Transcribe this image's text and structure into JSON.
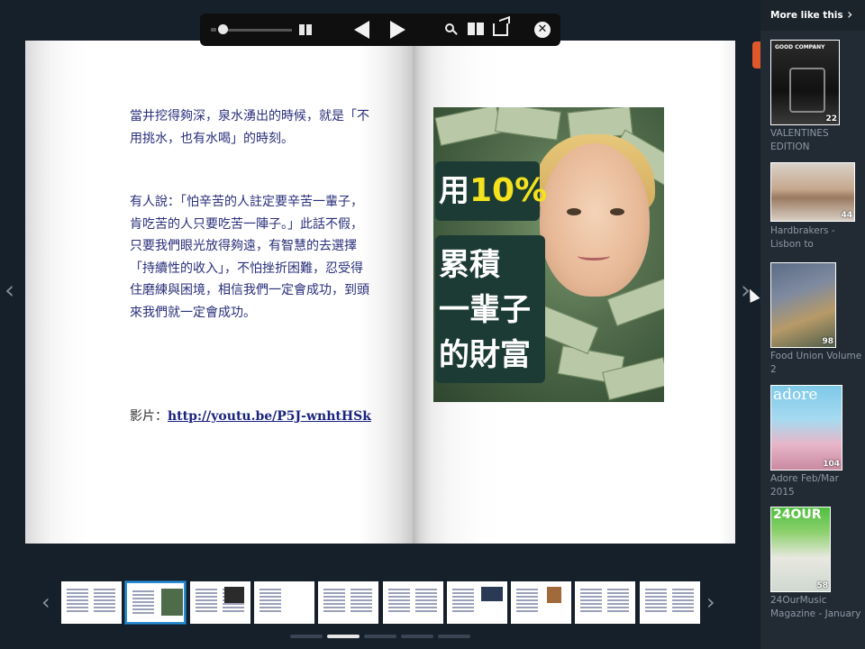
{
  "toolbar": {
    "icons": [
      "volume-icon",
      "slider",
      "grid-view-icon",
      "prev-page-icon",
      "next-page-icon",
      "search-icon",
      "pages-icon",
      "share-icon",
      "close-icon"
    ],
    "close_glyph": "✕"
  },
  "book": {
    "left_page": {
      "paragraph1": "當井挖得夠深，泉水湧出的時候，就是「不用挑水，也有水喝」的時刻。",
      "paragraph2": "有人說：「怕辛苦的人註定要辛苦一輩子，肯吃苦的人只要吃苦一陣子。」此話不假，只要我們眼光放得夠遠，有智慧的去選擇「持續性的收入」，不怕挫折困難，忍受得住磨練與困境，相信我們一定會成功，到頭來我們就一定會成功。",
      "video_label": "影片：",
      "video_link": "http://youtu.be/P5J-wnhtHSk"
    },
    "right_page": {
      "ad_line1_prefix": "用",
      "ad_line1_percent": "10%",
      "ad_line2": "累積",
      "ad_line3": "一輩子",
      "ad_line4": "的財富"
    }
  },
  "navigation": {
    "left_arrow": "‹",
    "right_arrow": "›"
  },
  "thumbnails": {
    "prev_arrow": "‹",
    "next_arrow": "›",
    "count": 10,
    "active_index": 1,
    "dot_count": 5,
    "active_dot": 1
  },
  "sidebar": {
    "title": "More like this",
    "chevron": "›",
    "accent_color": "#e0572a",
    "items": [
      {
        "title": "VALENTINES EDITION",
        "count": "22",
        "cover_text": "GOOD COMPANY"
      },
      {
        "title": "Hardbrakers - Lisbon to",
        "count": "44"
      },
      {
        "title": "Food Union Volume 2",
        "count": "98"
      },
      {
        "title": "Adore Feb/Mar 2015",
        "count": "104",
        "cover_text": "adore"
      },
      {
        "title": "24OurMusic Magazine - January",
        "count": "58",
        "cover_text": "24OUR"
      }
    ]
  }
}
